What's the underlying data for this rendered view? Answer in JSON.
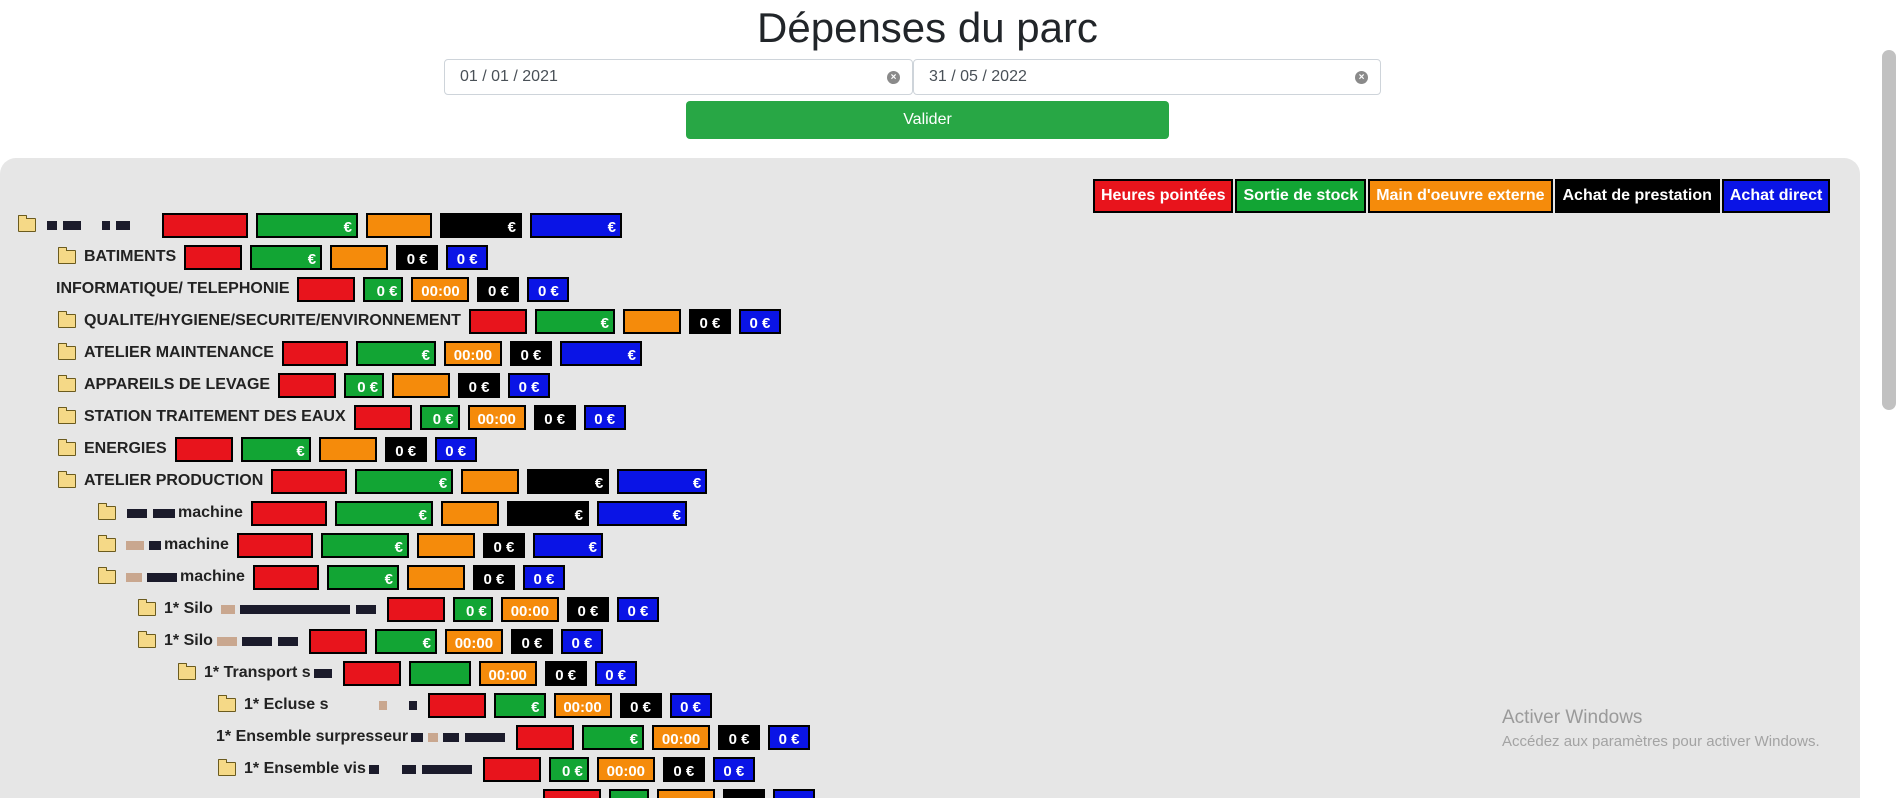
{
  "page": {
    "title": "Dépenses du parc",
    "date_start": "01 / 01 / 2021",
    "date_end": "31 / 05 / 2022",
    "validate_label": "Valider"
  },
  "legend": {
    "heures": "Heures pointées",
    "stock": "Sortie de stock",
    "mo_externe": "Main d'oeuvre externe",
    "prestation": "Achat de prestation",
    "direct": "Achat direct"
  },
  "colors": {
    "heures": "#e8141c",
    "stock": "#12a534",
    "mo_externe": "#f58b0b",
    "prestation": "#000000",
    "direct": "#0a14e6",
    "validate": "#28a745"
  },
  "tree": {
    "root": {
      "label": "",
      "heures": "",
      "stock": "€",
      "mo": "",
      "presta": "€",
      "direct": "€"
    },
    "batiments": {
      "label": "BATIMENTS",
      "heures": "",
      "stock": "€",
      "mo": "",
      "presta": "0 €",
      "direct": "0 €"
    },
    "informatique": {
      "label": "INFORMATIQUE/ TELEPHONIE",
      "heures": "",
      "stock": "0 €",
      "mo": "00:00",
      "presta": "0 €",
      "direct": "0 €"
    },
    "qualite": {
      "label": "QUALITE/HYGIENE/SECURITE/ENVIRONNEMENT",
      "heures": "",
      "stock": "€",
      "mo": "",
      "presta": "0 €",
      "direct": "0 €"
    },
    "atelier_maint": {
      "label": "ATELIER MAINTENANCE",
      "heures": "",
      "stock": "€",
      "mo": "00:00",
      "presta": "0 €",
      "direct": "€"
    },
    "levage": {
      "label": "APPAREILS DE LEVAGE",
      "heures": "",
      "stock": "0 €",
      "mo": "",
      "presta": "0 €",
      "direct": "0 €"
    },
    "station": {
      "label": "STATION TRAITEMENT DES EAUX",
      "heures": "",
      "stock": "0 €",
      "mo": "00:00",
      "presta": "0 €",
      "direct": "0 €"
    },
    "energies": {
      "label": "ENERGIES",
      "heures": "",
      "stock": "€",
      "mo": "",
      "presta": "0 €",
      "direct": "0 €"
    },
    "atelier_prod": {
      "label": "ATELIER PRODUCTION",
      "heures": "",
      "stock": "€",
      "mo": "",
      "presta": "€",
      "direct": "€"
    },
    "machine1": {
      "label": "machine",
      "heures": "",
      "stock": "€",
      "mo": "",
      "presta": "€",
      "direct": "€"
    },
    "machine2": {
      "label": "machine",
      "heures": "",
      "stock": "€",
      "mo": "",
      "presta": "0 €",
      "direct": "€"
    },
    "machine3": {
      "label": "machine",
      "heures": "",
      "stock": "€",
      "mo": "",
      "presta": "0 €",
      "direct": "0 €"
    },
    "silo1": {
      "label": "1* Silo",
      "heures": "",
      "stock": "0 €",
      "mo": "00:00",
      "presta": "0 €",
      "direct": "0 €"
    },
    "silo2": {
      "label": "1* Silo",
      "heures": "",
      "stock": "€",
      "mo": "00:00",
      "presta": "0 €",
      "direct": "0 €"
    },
    "transport": {
      "label": "1* Transport s",
      "heures": "",
      "stock": "",
      "mo": "00:00",
      "presta": "0 €",
      "direct": "0 €"
    },
    "ecluse": {
      "label": "1* Ecluse s",
      "heures": "",
      "stock": "€",
      "mo": "00:00",
      "presta": "0 €",
      "direct": "0 €"
    },
    "surpresseur": {
      "label": "1* Ensemble surpresseur",
      "heures": "",
      "stock": "€",
      "mo": "00:00",
      "presta": "0 €",
      "direct": "0 €"
    },
    "vis": {
      "label": "1* Ensemble vis",
      "heures": "",
      "stock": "0 €",
      "mo": "00:00",
      "presta": "0 €",
      "direct": "0 €"
    }
  },
  "watermark": {
    "line1": "Activer Windows",
    "line2": "Accédez aux paramètres pour activer Windows."
  }
}
